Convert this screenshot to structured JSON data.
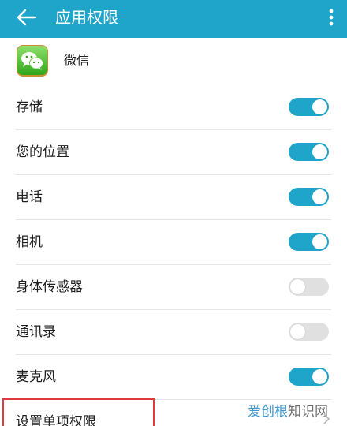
{
  "appbar": {
    "title": "应用权限",
    "background": "#1fa5c9",
    "back_icon": "arrow-left-icon",
    "more_icon": "more-vertical-icon"
  },
  "app": {
    "name": "微信",
    "icon": "wechat-icon",
    "icon_color": "#45c52a"
  },
  "permissions": [
    {
      "label": "存储",
      "enabled": true
    },
    {
      "label": "您的位置",
      "enabled": true
    },
    {
      "label": "电话",
      "enabled": true
    },
    {
      "label": "相机",
      "enabled": true
    },
    {
      "label": "身体传感器",
      "enabled": false
    },
    {
      "label": "通讯录",
      "enabled": false
    },
    {
      "label": "麦克风",
      "enabled": true
    }
  ],
  "single_permission": {
    "label": "设置单项权限",
    "chevron_icon": "chevron-right-icon",
    "highlight_color": "#e03a3a"
  },
  "watermark": {
    "part1": "爱创根",
    "part2": "知识网"
  },
  "colors": {
    "accent": "#1fa5c9",
    "toggle_off": "#e0e0e0"
  }
}
